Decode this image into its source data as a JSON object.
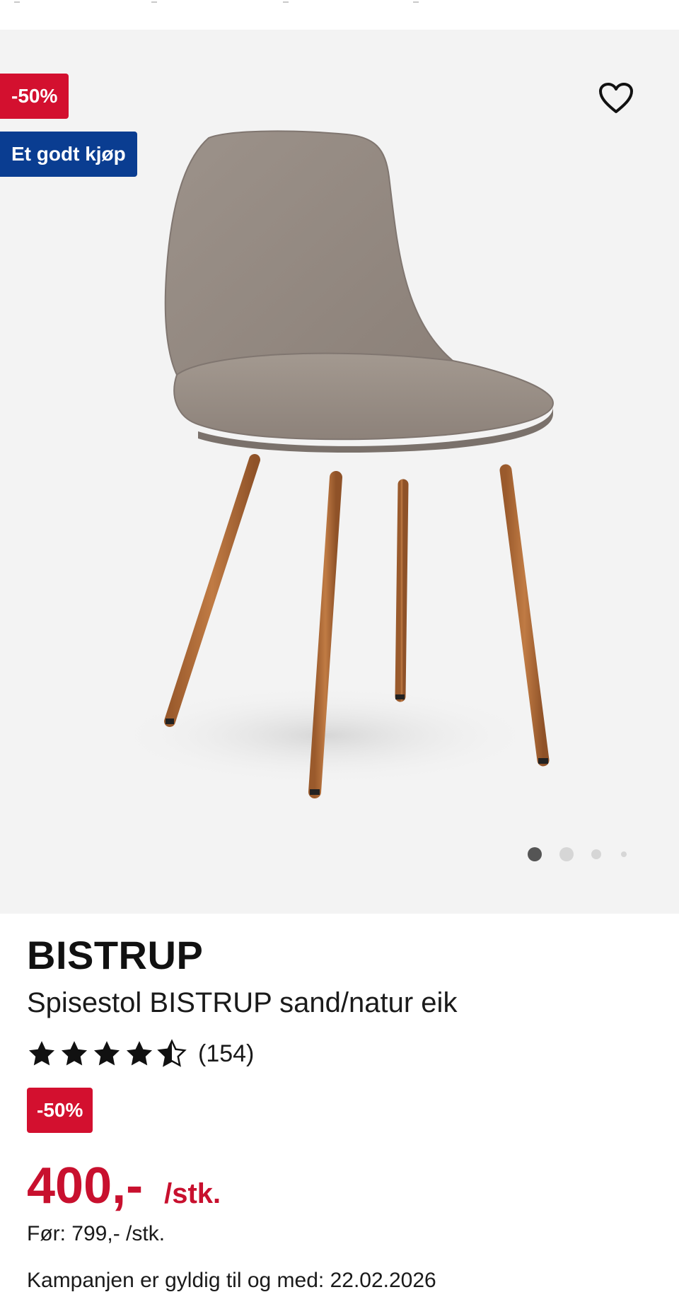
{
  "gallery": {
    "discount_badge": "-50%",
    "deal_badge": "Et godt kjøp",
    "favorite_icon": "heart-outline-icon",
    "image_alt": "Spisestol BISTRUP sand/natur eik",
    "slide_count": 4,
    "active_slide": 1
  },
  "product": {
    "brand": "BISTRUP",
    "name": "Spisestol BISTRUP sand/natur eik",
    "rating": 4.5,
    "rating_max": 5,
    "review_count": "(154)",
    "discount_badge": "-50%",
    "price": "400,-",
    "price_unit": "/stk.",
    "before_price": "Før: 799,- /stk.",
    "campaign_text": "Kampanjen er gyldig til og med: 22.02.2026"
  },
  "colors": {
    "discount_red": "#d3102f",
    "deal_blue": "#0a3d91",
    "price_red": "#c8102e",
    "gallery_bg": "#f3f3f3"
  }
}
